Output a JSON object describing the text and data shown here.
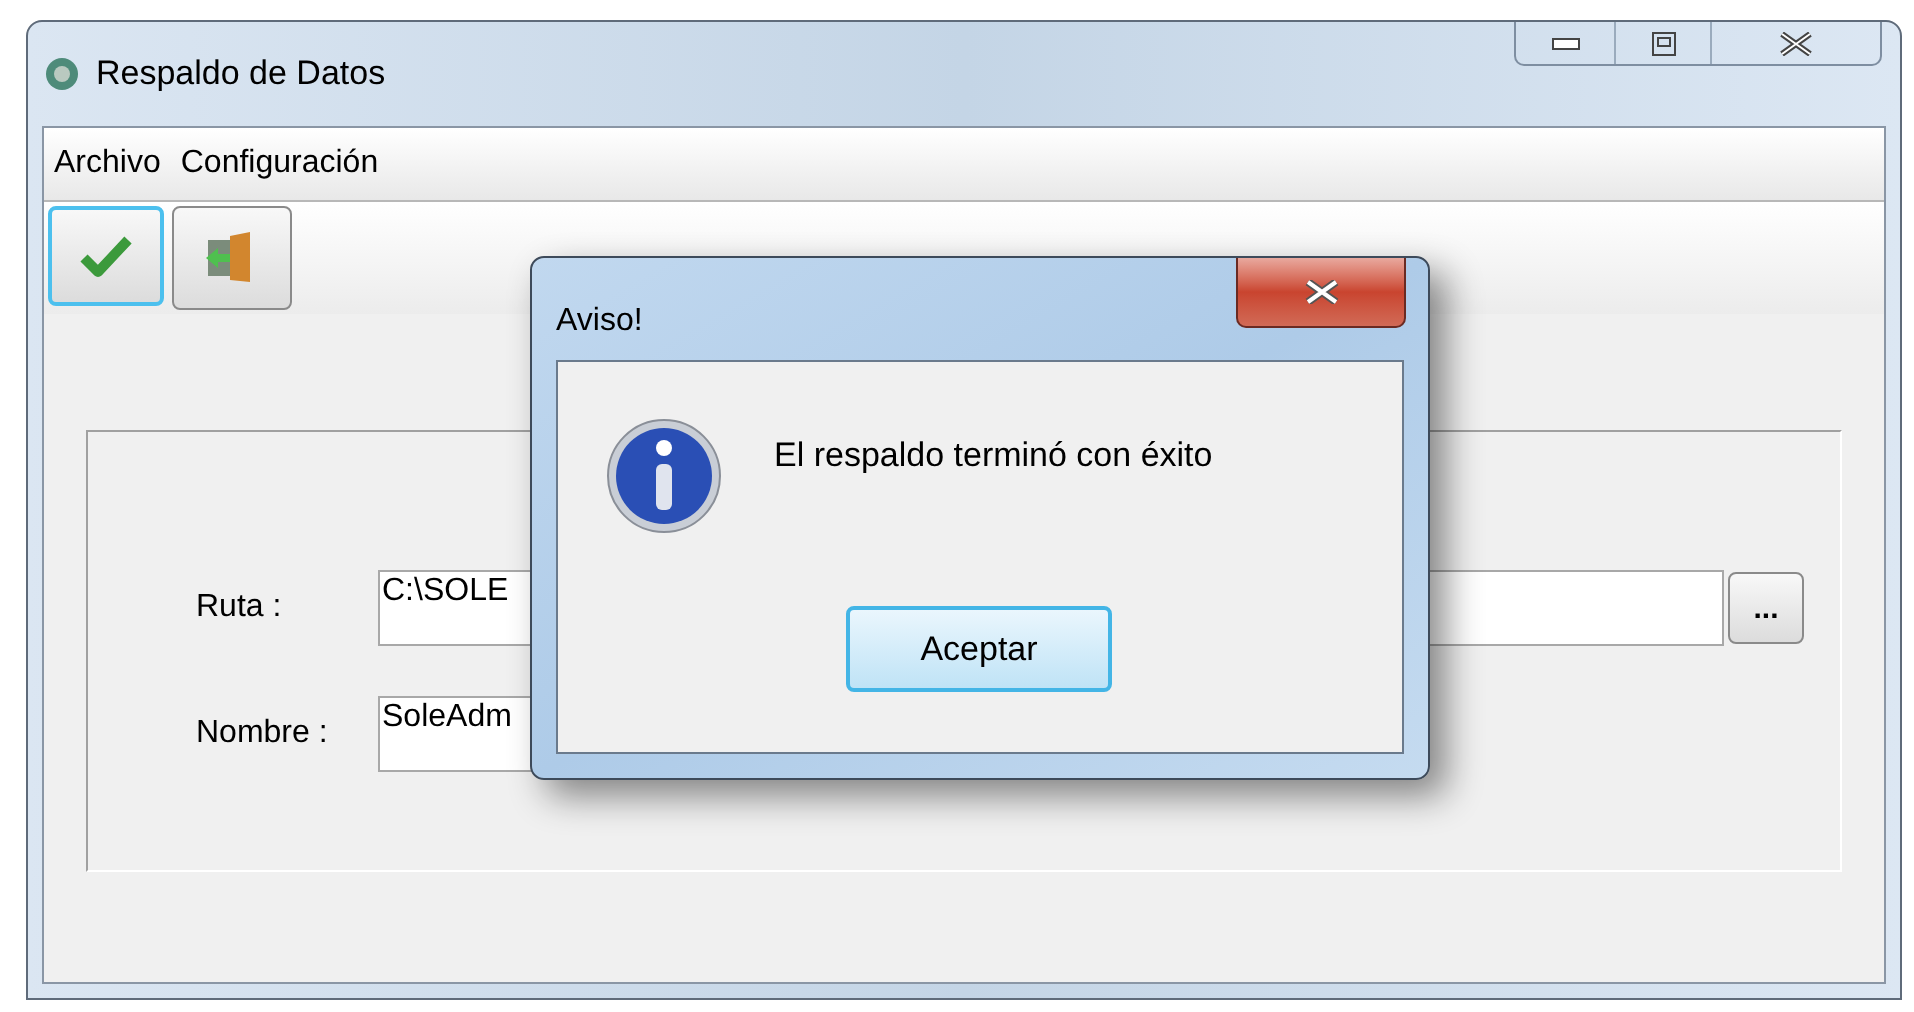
{
  "window": {
    "title": "Respaldo de Datos"
  },
  "menu": [
    "Archivo",
    "Configuración"
  ],
  "form": {
    "fields": [
      {
        "label": "Ruta :",
        "value": "C:\\SOLE",
        "browse": "..."
      },
      {
        "label": "Nombre :",
        "value": "SoleAdm"
      }
    ]
  },
  "dialog": {
    "title": "Aviso!",
    "message": "El respaldo terminó con éxito",
    "button": "Aceptar"
  }
}
